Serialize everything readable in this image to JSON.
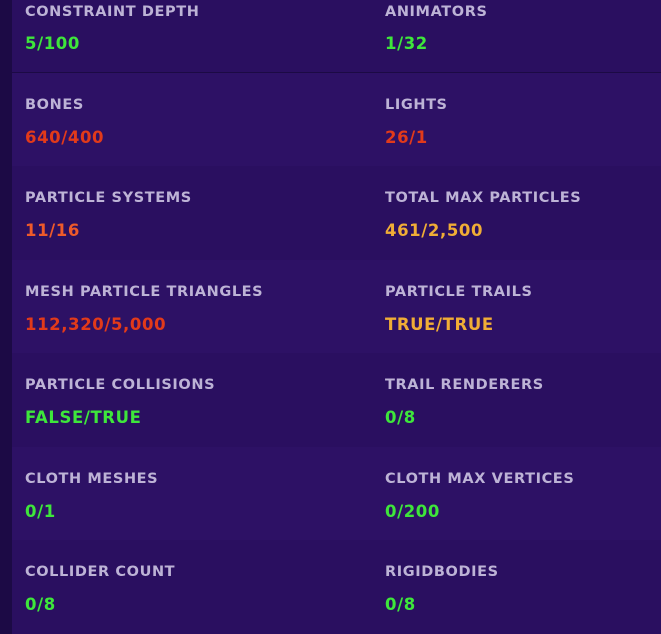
{
  "stats": [
    {
      "left": {
        "label": "CONSTRAINT DEPTH",
        "value": "5/100",
        "status": "ok"
      },
      "right": {
        "label": "ANIMATORS",
        "value": "1/32",
        "status": "ok"
      }
    },
    {
      "left": {
        "label": "BONES",
        "value": "640/400",
        "status": "over"
      },
      "right": {
        "label": "LIGHTS",
        "value": "26/1",
        "status": "over"
      }
    },
    {
      "left": {
        "label": "PARTICLE SYSTEMS",
        "value": "11/16",
        "status": "warn-high"
      },
      "right": {
        "label": "TOTAL MAX PARTICLES",
        "value": "461/2,500",
        "status": "warn"
      }
    },
    {
      "left": {
        "label": "MESH PARTICLE TRIANGLES",
        "value": "112,320/5,000",
        "status": "over"
      },
      "right": {
        "label": "PARTICLE TRAILS",
        "value": "TRUE/TRUE",
        "status": "warn"
      }
    },
    {
      "left": {
        "label": "PARTICLE COLLISIONS",
        "value": "FALSE/TRUE",
        "status": "ok"
      },
      "right": {
        "label": "TRAIL RENDERERS",
        "value": "0/8",
        "status": "ok"
      }
    },
    {
      "left": {
        "label": "CLOTH MESHES",
        "value": "0/1",
        "status": "ok"
      },
      "right": {
        "label": "CLOTH MAX VERTICES",
        "value": "0/200",
        "status": "ok"
      }
    },
    {
      "left": {
        "label": "COLLIDER COUNT",
        "value": "0/8",
        "status": "ok"
      },
      "right": {
        "label": "RIGIDBODIES",
        "value": "0/8",
        "status": "ok"
      }
    }
  ],
  "colors": {
    "background": "#1c0a45",
    "row_dark": "#2a0f60",
    "row_light": "#2d1165",
    "label": "#bdb3d6",
    "ok": "#3ee63b",
    "over": "#e23a1a",
    "warn_high": "#ee5a2a",
    "warn": "#f0ad36"
  }
}
